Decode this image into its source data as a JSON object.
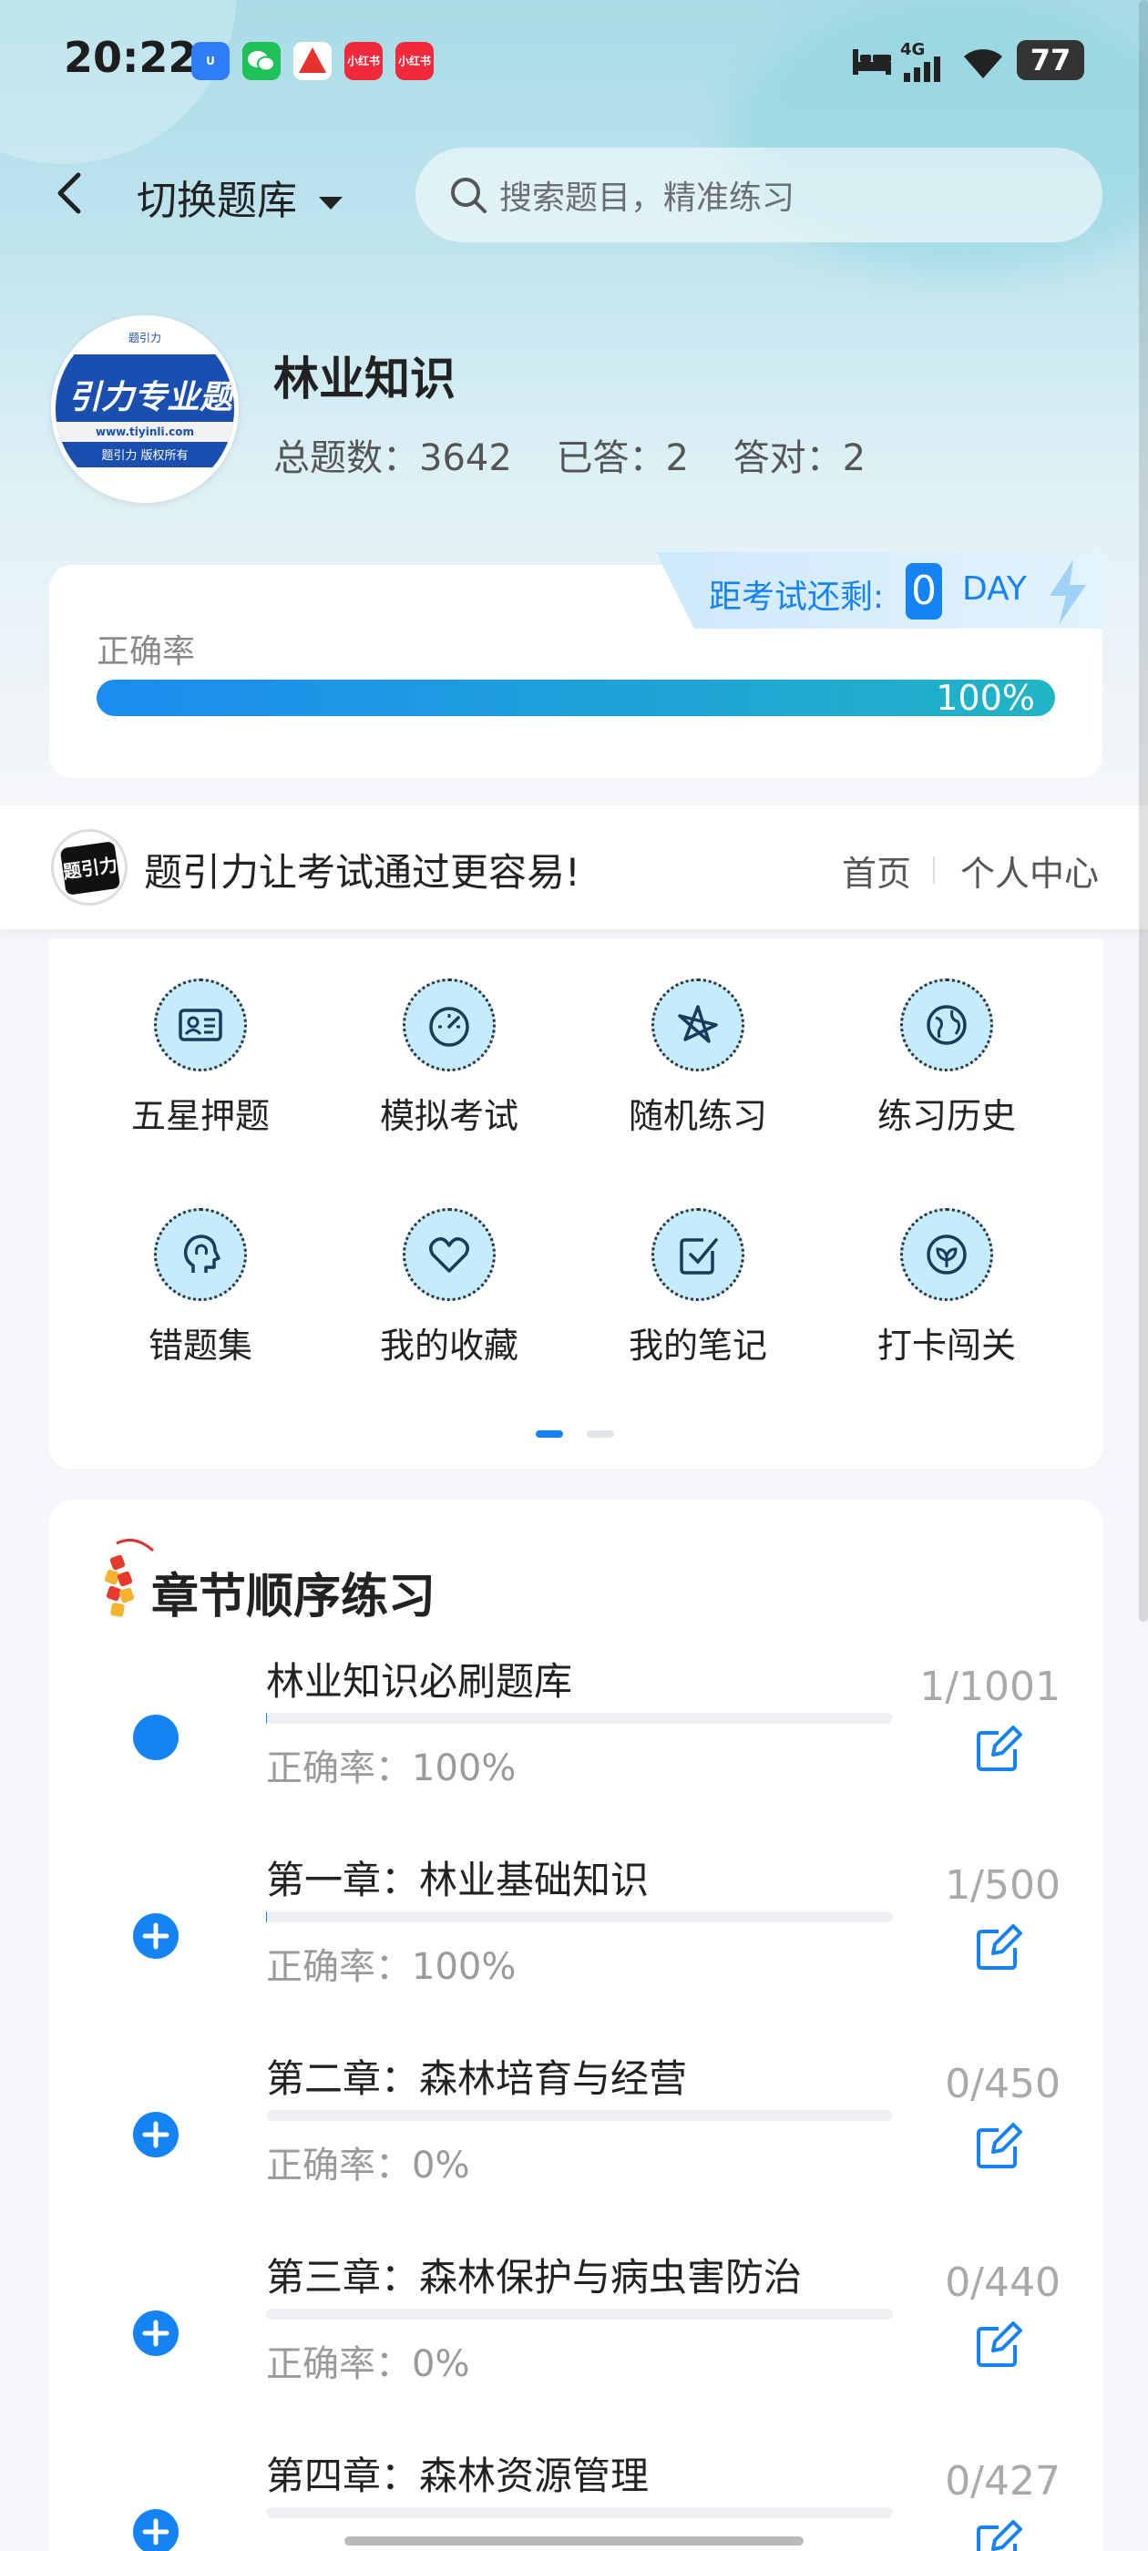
{
  "status_bar": {
    "time": "20:22",
    "network": "4G",
    "battery": "77",
    "notif_icons": [
      "app-icon",
      "wechat-icon",
      "app-icon",
      "xiaohongshu-icon",
      "xiaohongshu-icon"
    ],
    "notif_label": "小红书"
  },
  "header": {
    "switch_label": "切换题库",
    "search_placeholder": "搜索题目，精准练习"
  },
  "profile": {
    "logo_text": "引力专业题",
    "logo_url": "www.tiyinli.com",
    "logo_footer": "题引力 版权所有",
    "logo_top": "题引力",
    "title": "林业知识",
    "total_label": "总题数：3642",
    "answered_label": "已答：2",
    "correct_label": "答对：2"
  },
  "exam": {
    "prefix": "距考试还剩:",
    "days": "0",
    "unit": "DAY"
  },
  "accuracy": {
    "label": "正确率",
    "value_text": "100%",
    "value": 1.0
  },
  "slogan": {
    "logo_text": "题引力",
    "text": "题引力让考试通过更容易!",
    "links": [
      "首页",
      "个人中心"
    ]
  },
  "grid": {
    "items": [
      {
        "label": "五星押题",
        "icon": "id-card-icon"
      },
      {
        "label": "模拟考试",
        "icon": "speedometer-icon"
      },
      {
        "label": "随机练习",
        "icon": "random-icon"
      },
      {
        "label": "练习历史",
        "icon": "globe-icon"
      },
      {
        "label": "错题集",
        "icon": "head-icon"
      },
      {
        "label": "我的收藏",
        "icon": "heart-icon"
      },
      {
        "label": "我的笔记",
        "icon": "note-check-icon"
      },
      {
        "label": "打卡闯关",
        "icon": "leaf-icon"
      }
    ],
    "page_count": 2,
    "active_page": 1
  },
  "chapters": {
    "title": "章节顺序练习",
    "items": [
      {
        "name": "林业知识必刷题库",
        "rate": "正确率：100%",
        "count": "1/1001",
        "progress": 0.001,
        "state": "current"
      },
      {
        "name": "第一章：林业基础知识",
        "rate": "正确率：100%",
        "count": "1/500",
        "progress": 0.002,
        "state": "expand"
      },
      {
        "name": "第二章：森林培育与经营",
        "rate": "正确率：0%",
        "count": "0/450",
        "progress": 0,
        "state": "expand"
      },
      {
        "name": "第三章：森林保护与病虫害防治",
        "rate": "正确率：0%",
        "count": "0/440",
        "progress": 0,
        "state": "expand"
      },
      {
        "name": "第四章：森林资源管理",
        "rate": "",
        "count": "0/427",
        "progress": 0,
        "state": "expand"
      }
    ]
  },
  "colors": {
    "accent": "#1683f5",
    "bar_start": "#1b8cf0",
    "bar_end": "#21b4c5",
    "icon_bg": "#c4ecfc"
  }
}
